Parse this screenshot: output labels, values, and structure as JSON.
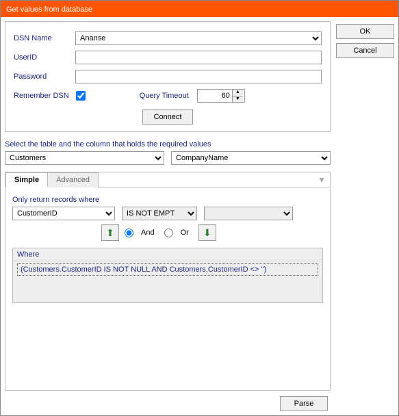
{
  "title": "Get values from database",
  "sidebar": {
    "ok": "OK",
    "cancel": "Cancel"
  },
  "conn": {
    "dsn_label": "DSN Name",
    "dsn_value": "Ananse",
    "user_label": "UserID",
    "user_value": "",
    "pass_label": "Password",
    "pass_value": "",
    "remember_label": "Remember DSN",
    "remember_checked": true,
    "timeout_label": "Query Timeout",
    "timeout_value": "60",
    "connect": "Connect"
  },
  "tablecol": {
    "label": "Select the table and the column that holds the required values",
    "table": "Customers",
    "column": "CompanyName"
  },
  "tabs": {
    "simple": "Simple",
    "advanced": "Advanced"
  },
  "criteria": {
    "label": "Only return records where",
    "field": "CustomerID",
    "op": "IS NOT EMPT",
    "value": "",
    "and": "And",
    "or": "Or",
    "where_hdr": "Where",
    "where_text": "(Customers.CustomerID IS NOT NULL AND Customers.CustomerID <> '')"
  },
  "footer": {
    "parse": "Parse"
  }
}
